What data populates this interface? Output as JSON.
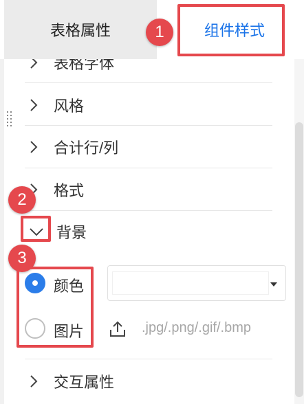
{
  "tabs": [
    {
      "label": "表格属性",
      "active": false
    },
    {
      "label": "组件样式",
      "active": true
    }
  ],
  "badges": [
    "1",
    "2",
    "3"
  ],
  "sections": {
    "font": "表格字体",
    "style": "风格",
    "totals": "合计行/列",
    "format": "格式",
    "background": "背景",
    "interaction": "交互属性"
  },
  "background": {
    "options": [
      {
        "label": "颜色",
        "selected": true
      },
      {
        "label": "图片",
        "selected": false
      }
    ],
    "color_value": "",
    "upload_hint": ".jpg/.png/.gif/.bmp"
  },
  "colors": {
    "accent": "#1a73e8",
    "highlight": "#e5484d",
    "radio": "#2b7de9"
  },
  "icons": {
    "expand": "chevron-right-icon",
    "collapse": "chevron-down-icon",
    "upload": "upload-icon",
    "dropdown": "caret-down-icon",
    "drag": "drag-handle-icon"
  }
}
